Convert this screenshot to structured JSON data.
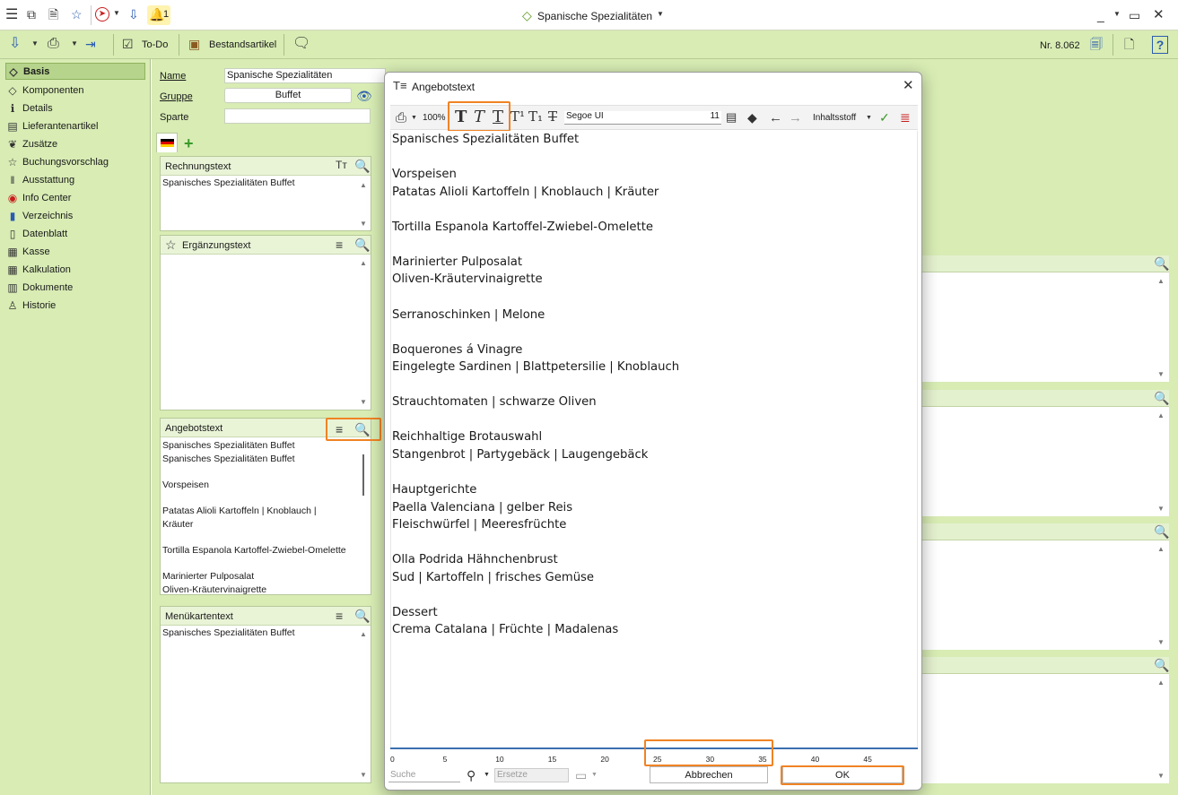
{
  "window": {
    "title": "Spanische Spezialitäten",
    "notification_count": "1"
  },
  "toolbar": {
    "todo_label": "To-Do",
    "bestand_label": "Bestandsartikel",
    "number_label": "Nr. 8.062"
  },
  "nav": {
    "items": [
      {
        "label": "Basis",
        "icon": "tag-icon"
      },
      {
        "label": "Komponenten",
        "icon": "tag-icon"
      },
      {
        "label": "Details",
        "icon": "info-icon"
      },
      {
        "label": "Lieferantenartikel",
        "icon": "supplier-icon"
      },
      {
        "label": "Zusätze",
        "icon": "leaf-icon"
      },
      {
        "label": "Buchungsvorschlag",
        "icon": "star-icon"
      },
      {
        "label": "Ausstattung",
        "icon": "barcode-icon"
      },
      {
        "label": "Info Center",
        "icon": "compass-icon"
      },
      {
        "label": "Verzeichnis",
        "icon": "book-icon"
      },
      {
        "label": "Datenblatt",
        "icon": "document-icon"
      },
      {
        "label": "Kasse",
        "icon": "register-icon"
      },
      {
        "label": "Kalkulation",
        "icon": "grid-icon"
      },
      {
        "label": "Dokumente",
        "icon": "documents-icon"
      },
      {
        "label": "Historie",
        "icon": "history-icon"
      }
    ]
  },
  "form": {
    "name_label": "Name",
    "name_value": "Spanische Spezialitäten",
    "gruppe_label": "Gruppe",
    "gruppe_value": "Buffet",
    "sparte_label": "Sparte",
    "sparte_value": ""
  },
  "panels": {
    "rechnungstext": {
      "title": "Rechnungstext",
      "text": "Spanisches Spezialitäten Buffet"
    },
    "ergaenzungstext": {
      "title": "Ergänzungstext",
      "text": ""
    },
    "angebotstext": {
      "title": "Angebotstext",
      "text": "Spanisches Spezialitäten Buffet\nSpanisches Spezialitäten Buffet\n\nVorspeisen\n\nPatatas Alioli Kartoffeln | Knoblauch |\nKräuter\n\nTortilla Espanola Kartoffel-Zwiebel-Omelette\n\nMarinierter Pulposalat\nOliven-Kräutervinaigrette"
    },
    "menuekartentext": {
      "title": "Menükartentext",
      "text": "Spanisches Spezialitäten Buffet"
    }
  },
  "dialog": {
    "title": "Angebotstext",
    "zoom": "100%",
    "font_name": "Segoe UI",
    "font_size": "11",
    "style_dropdown": "Inhaltsstoff",
    "lines": [
      "Spanisches Spezialitäten Buffet",
      "",
      "Vorspeisen",
      "Patatas Alioli Kartoffeln | Knoblauch | Kräuter",
      "",
      "Tortilla Espanola Kartoffel-Zwiebel-Omelette",
      "",
      "Marinierter Pulposalat",
      "Oliven-Kräutervinaigrette",
      "",
      "Serranoschinken | Melone",
      "",
      "Boquerones á Vinagre",
      "Eingelegte Sardinen | Blattpetersilie | Knoblauch",
      "",
      "Strauchtomaten | schwarze Oliven",
      "",
      "Reichhaltige Brotauswahl",
      "Stangenbrot | Partygebäck | Laugengebäck",
      "",
      "Hauptgerichte",
      "Paella Valenciana | gelber Reis",
      "Fleischwürfel | Meeresfrüchte",
      "",
      "Olla Podrida Hähnchenbrust",
      "Sud | Kartoffeln | frisches Gemüse",
      "",
      "Dessert",
      "Crema Catalana | Früchte | Madalenas"
    ],
    "ruler": [
      "0",
      "5",
      "10",
      "15",
      "20",
      "25",
      "30",
      "35",
      "40",
      "45"
    ],
    "search_placeholder": "Suche",
    "replace_placeholder": "Ersetze",
    "cancel_label": "Abbrechen",
    "ok_label": "OK"
  },
  "colors": {
    "accent_green": "#d8ecb4",
    "highlight_orange": "#f08324"
  }
}
